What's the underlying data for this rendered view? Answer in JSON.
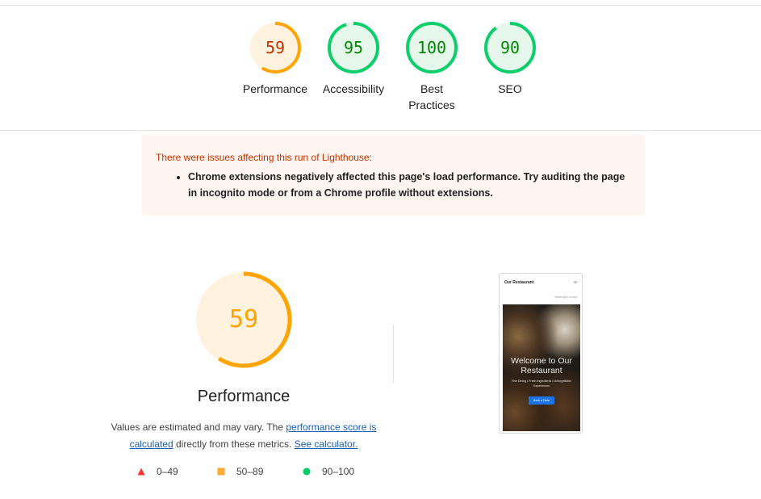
{
  "scores": [
    {
      "value": "59",
      "label": "Performance",
      "score": 0.59,
      "color": "#ffa400",
      "text_color": "#c33300",
      "fill": "#fff3e0"
    },
    {
      "value": "95",
      "label": "Accessibility",
      "score": 0.95,
      "color": "#0cce6b",
      "text_color": "#008800",
      "fill": "#e6f7ec"
    },
    {
      "value": "100",
      "label_line1": "Best",
      "label_line2": "Practices",
      "score": 1.0,
      "color": "#0cce6b",
      "text_color": "#008800",
      "fill": "#e6f7ec"
    },
    {
      "value": "90",
      "label": "SEO",
      "score": 0.9,
      "color": "#0cce6b",
      "text_color": "#008800",
      "fill": "#e6f7ec"
    }
  ],
  "warning": {
    "title": "There were issues affecting this run of Lighthouse:",
    "item": "Chrome extensions negatively affected this page's load performance. Try auditing the page in incognito mode or from a Chrome profile without extensions."
  },
  "performance": {
    "score_text": "59",
    "score": 0.59,
    "title": "Performance",
    "desc_prefix": "Values are estimated and may vary. The ",
    "desc_link1": "performance score is calculated",
    "desc_middle": " directly from these metrics. ",
    "desc_link2": "See calculator."
  },
  "legend": [
    {
      "range": "0–49",
      "color": "#ff3333",
      "icon": "triangle-icon"
    },
    {
      "range": "50–89",
      "color": "#ffaa33",
      "icon": "square-icon"
    },
    {
      "range": "90–100",
      "color": "#00cc66",
      "icon": "circle-icon"
    }
  ],
  "screenshot": {
    "brand": "Our Restaurant",
    "menu_icon": "≡",
    "sub": "Yesterday's crowd",
    "hero_title": "Welcome to Our Restaurant",
    "hero_sub": "Fine Dining • Fresh Ingredients • Unforgettable Experiences",
    "button": "Book a Table"
  }
}
